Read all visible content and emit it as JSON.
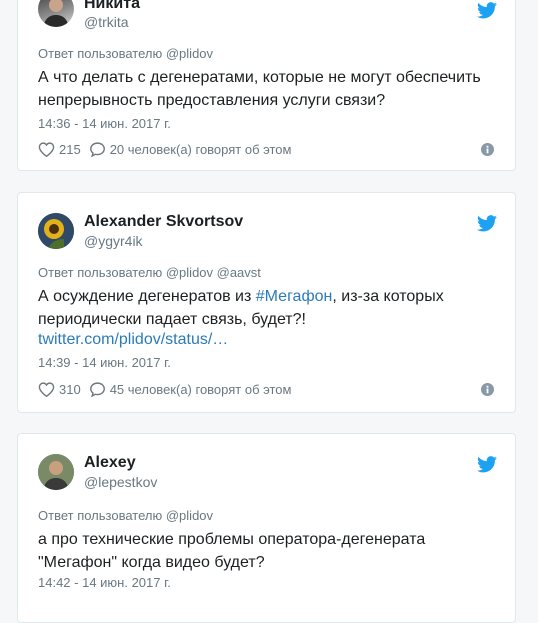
{
  "colors": {
    "accent": "#1da1f2",
    "link": "#2b7bb9",
    "muted": "#697882",
    "text": "#1c2022"
  },
  "tweets": [
    {
      "name": "Никита",
      "handle": "@trkita",
      "reply_prefix": "Ответ пользователю",
      "reply_to": "@plidov",
      "text": "А что делать с дегенератами, которые не могут обеспечить непрерывность предоставления услуги связи?",
      "time": "14:36 - 14 июн. 2017 г.",
      "likes": "215",
      "talk": "20 человек(а) говорят об этом"
    },
    {
      "name": "Alexander Skvortsov",
      "handle": "@ygyr4ik",
      "reply_prefix": "Ответ пользователю",
      "reply_to": "@plidov @aavst",
      "text_before": "А осуждение дегенератов из ",
      "hashtag": "#Мегафон",
      "text_after": ", из-за которых периодически падает связь, будет?!",
      "link": "twitter.com/plidov/status/…",
      "time": "14:39 - 14 июн. 2017 г.",
      "likes": "310",
      "talk": "45 человек(а) говорят об этом"
    },
    {
      "name": "Alexey",
      "handle": "@lepestkov",
      "reply_prefix": "Ответ пользователю",
      "reply_to": "@plidov",
      "text": "а про технические проблемы оператора-дегенерата \"Мегафон\" когда видео будет?",
      "time": "14:42 - 14 июн. 2017 г."
    }
  ]
}
